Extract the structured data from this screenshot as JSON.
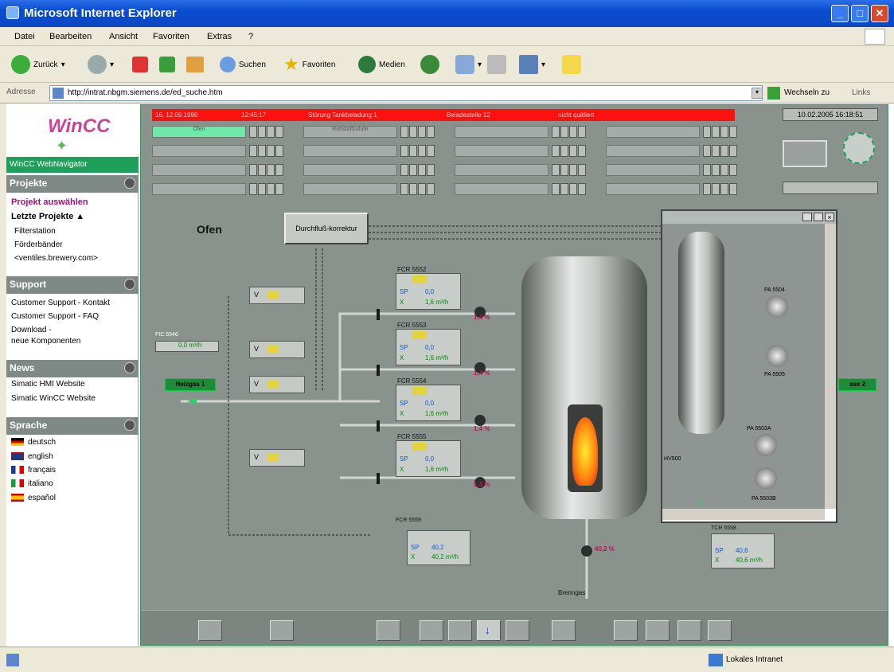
{
  "window": {
    "title": "Microsoft Internet Explorer"
  },
  "menu": [
    "Datei",
    "Bearbeiten",
    "Ansicht",
    "Favoriten",
    "Extras",
    "?"
  ],
  "toolbar": {
    "back": "Zurück",
    "search": "Suchen",
    "favorites": "Favoriten",
    "media": "Medien"
  },
  "address": {
    "label": "Adresse",
    "url": "http://intrat.nbgm.siemens.de/ed_suche.htm",
    "go": "Wechseln zu",
    "links": "Links"
  },
  "sidebar": {
    "logo": "WinCC",
    "navigator": "WinCC WebNavigator",
    "projekte": {
      "title": "Projekte",
      "select": "Projekt auswählen",
      "recent": "Letzte Projekte",
      "items": [
        "Filterstation",
        "Förderbänder",
        "<ventiles.brewery.com>"
      ]
    },
    "support": {
      "title": "Support",
      "items": [
        "Customer Support - Kontakt",
        "Customer Support - FAQ",
        "Download -",
        "neue Komponenten"
      ]
    },
    "news": {
      "title": "News",
      "items": [
        "Simatic HMI Website",
        "Simatic WinCC Website"
      ]
    },
    "sprache": {
      "title": "Sprache",
      "items": [
        "deutsch",
        "english",
        "français",
        "italiano",
        "español"
      ]
    }
  },
  "hmi": {
    "alarm": {
      "date": "16. 12.09.1999",
      "time": "12:45:17",
      "text": "Störung Tankbeladung 1",
      "place": "Beladestelle 12",
      "state": "nicht quittiert"
    },
    "datetime": "10.02.2005 16:18:51",
    "bar_labels": [
      "Ofen",
      "Rohstoffzufuhr"
    ],
    "title": "Ofen",
    "flow_button": "Durchfluß-korrektur",
    "fic": {
      "tag": "FIC 5546",
      "x": "0,0 m³/h"
    },
    "gas_left": "Heizgas 1",
    "gas_right": "ase 2",
    "controllers": [
      {
        "tag": "FCR 5552",
        "sp": "0,0",
        "x": "1,6 m³/h",
        "pct": "1,4 %"
      },
      {
        "tag": "FCR 5553",
        "sp": "0,0",
        "x": "1,6 m³/h",
        "pct": "1,4 %"
      },
      {
        "tag": "FCR 5554",
        "sp": "0,0",
        "x": "1,6 m³/h",
        "pct": "1,4 %"
      },
      {
        "tag": "FCR 5555",
        "sp": "0,0",
        "x": "1,6 m³/h",
        "pct": "1,4 %"
      }
    ],
    "fcr_bottom": {
      "tag": "FCR 5559",
      "sp": "40,2",
      "x": "40,2 m³/h",
      "pct": "40,2 %"
    },
    "tcr": {
      "tag": "TCR 5558",
      "sp": "40,6",
      "x": "40,6 m³/h"
    },
    "burner": "Brenngas",
    "v_label": "V",
    "popup": {
      "pumps": [
        "PA 5504",
        "PA 5505",
        "PA 5503A",
        "PA 5503B"
      ],
      "valve": "HV500"
    }
  },
  "status": {
    "zone": "Lokales Intranet"
  }
}
